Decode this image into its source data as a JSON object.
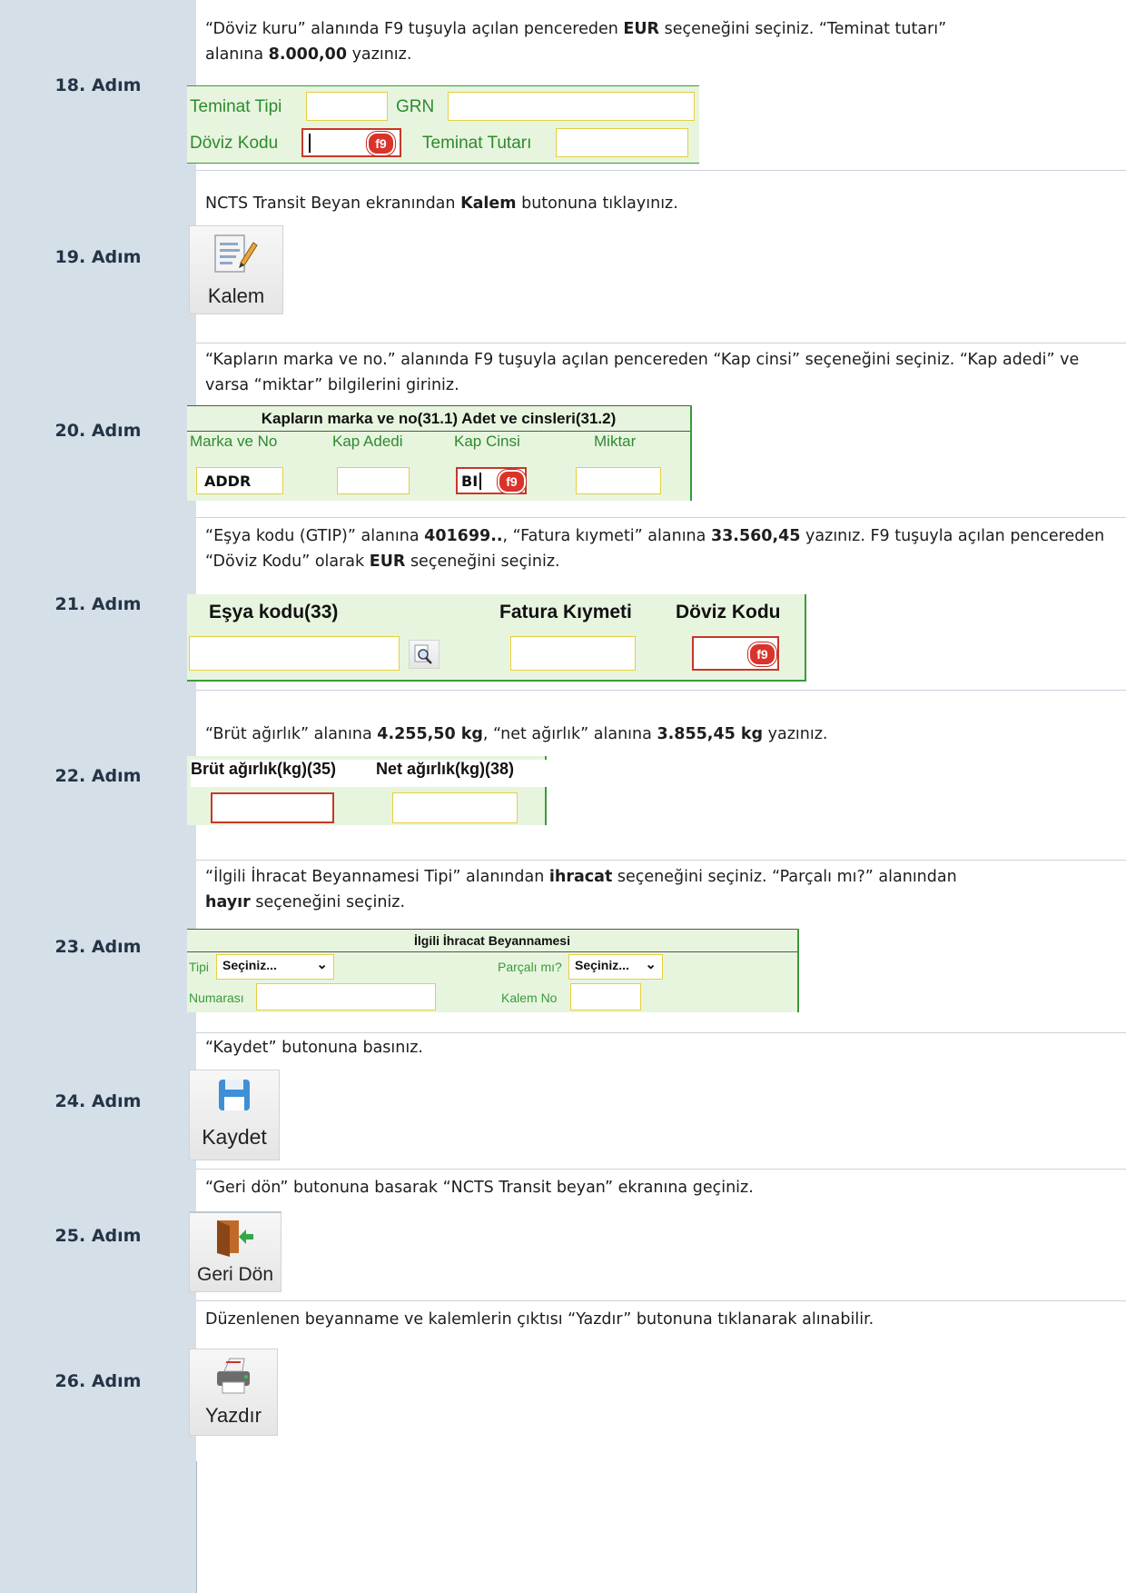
{
  "steps": [
    {
      "label": "18. Adım",
      "text_html": "“Döviz kuru” alanında F9 tuşuyla açılan pencereden <b>EUR</b> seçeneğini seçiniz. “Teminat tutarı” alanına <b>8.000,00</b> yazınız."
    },
    {
      "label": "19. Adım",
      "text_html": "NCTS Transit Beyan ekranından <b>Kalem</b> butonuna tıklayınız."
    },
    {
      "label": "20. Adım",
      "text_html": "“Kapların marka ve no.” alanında F9 tuşuyla açılan pencereden “Kap cinsi” seçeneğini seçiniz.  “Kap adedi” ve varsa “miktar” bilgilerini giriniz."
    },
    {
      "label": "21. Adım",
      "text_html": "“Eşya kodu (GTIP)” alanına <b>401699..</b>, “Fatura kıymeti” alanına <b>33.560,45</b> yazınız. F9 tuşuyla açılan pencereden “Döviz Kodu” olarak <b>EUR</b> seçeneğini seçiniz."
    },
    {
      "label": "22. Adım",
      "text_html": "“Brüt ağırlık” alanına <b>4.255,50 kg</b>, “net ağırlık” alanına <b>3.855,45 kg</b> yazınız."
    },
    {
      "label": "23. Adım",
      "text_html": "“İlgili İhracat Beyannamesi Tipi”  alanından <b>ihracat</b> seçeneğini seçiniz. “Parçalı mı?” alanından <b>hayır</b> seçeneğini seçiniz."
    },
    {
      "label": "24. Adım",
      "text_html": "“Kaydet” butonuna basınız."
    },
    {
      "label": "25. Adım",
      "text_html": "“Geri dön” butonuna basarak “NCTS Transit beyan” ekranına geçiniz."
    },
    {
      "label": "26. Adım",
      "text_html": "Düzenlenen beyanname ve kalemlerin çıktısı “Yazdır” butonuna tıklanarak alınabilir."
    }
  ],
  "s18": {
    "teminat_tipi": "Teminat Tipi",
    "grn": "GRN",
    "doviz_kodu": "Döviz Kodu",
    "teminat_tutari": "Teminat Tutarı",
    "f9": "f9"
  },
  "s19": {
    "button": "Kalem",
    "icon": "document-edit-icon"
  },
  "s20": {
    "header": "Kapların marka ve no(31.1) Adet ve cinsleri(31.2)",
    "col1": "Marka ve No",
    "col2": "Kap Adedi",
    "col3": "Kap Cinsi",
    "col4": "Miktar",
    "marka_value": "ADDR",
    "cins_value": "BI",
    "f9": "f9"
  },
  "s21": {
    "col1": "Eşya kodu(33)",
    "col2": "Fatura Kıymeti",
    "col3": "Döviz Kodu",
    "f9": "f9",
    "icon": "magnifier-icon"
  },
  "s22": {
    "col1": "Brüt ağırlık(kg)(35)",
    "col2": "Net ağırlık(kg)(38)"
  },
  "s23": {
    "header": "İlgili İhracat Beyannamesi",
    "tipi": "Tipi",
    "tipi_value": "Seçiniz...",
    "parcali": "Parçalı mı?",
    "parcali_value": "Seçiniz...",
    "numarasi": "Numarası",
    "kalem_no": "Kalem No"
  },
  "s24": {
    "button": "Kaydet",
    "icon": "floppy-disk-icon"
  },
  "s25": {
    "button": "Geri Dön",
    "icon": "door-exit-icon"
  },
  "s26": {
    "button": "Yazdır",
    "icon": "printer-icon"
  }
}
